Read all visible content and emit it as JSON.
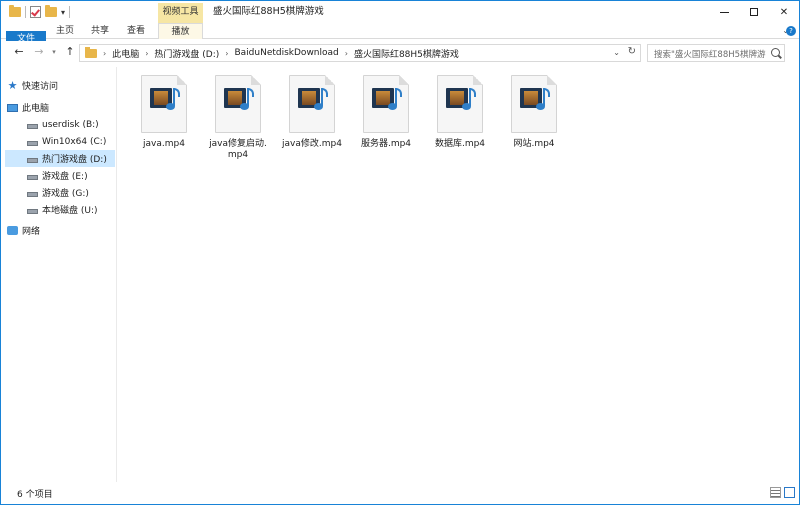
{
  "window": {
    "title": "盛火国际红88H5棋牌游戏",
    "contextual_tab_group": "视频工具"
  },
  "ribbon": {
    "tabs": [
      {
        "label": "文件"
      },
      {
        "label": "主页"
      },
      {
        "label": "共享"
      },
      {
        "label": "查看"
      },
      {
        "label": "播放"
      }
    ]
  },
  "address": {
    "breadcrumbs": [
      "此电脑",
      "热门游戏盘 (D:)",
      "BaiduNetdiskDownload",
      "盛火国际红88H5棋牌游戏"
    ]
  },
  "search": {
    "placeholder": "搜索\"盛火国际红88H5棋牌游..."
  },
  "navpane": {
    "quick_access": "快速访问",
    "this_pc": "此电脑",
    "drives": [
      {
        "label": "userdisk (B:)"
      },
      {
        "label": "Win10x64 (C:)"
      },
      {
        "label": "热门游戏盘 (D:)",
        "selected": true
      },
      {
        "label": "游戏盘 (E:)"
      },
      {
        "label": "游戏盘 (G:)"
      },
      {
        "label": "本地磁盘 (U:)"
      }
    ],
    "network": "网络"
  },
  "files": [
    {
      "name": "java.mp4",
      "icon": "video-file-icon"
    },
    {
      "name": "java修复启动.mp4",
      "icon": "video-file-icon"
    },
    {
      "name": "java修改.mp4",
      "icon": "video-file-icon"
    },
    {
      "name": "服务器.mp4",
      "icon": "video-file-icon"
    },
    {
      "name": "数据库.mp4",
      "icon": "video-file-icon"
    },
    {
      "name": "网站.mp4",
      "icon": "video-file-icon"
    }
  ],
  "status": {
    "item_count": "6 个项目"
  },
  "colors": {
    "accent": "#1979ca",
    "context_tab": "#f6e6a4",
    "selection": "#cce8ff",
    "folder": "#e8b64a"
  }
}
